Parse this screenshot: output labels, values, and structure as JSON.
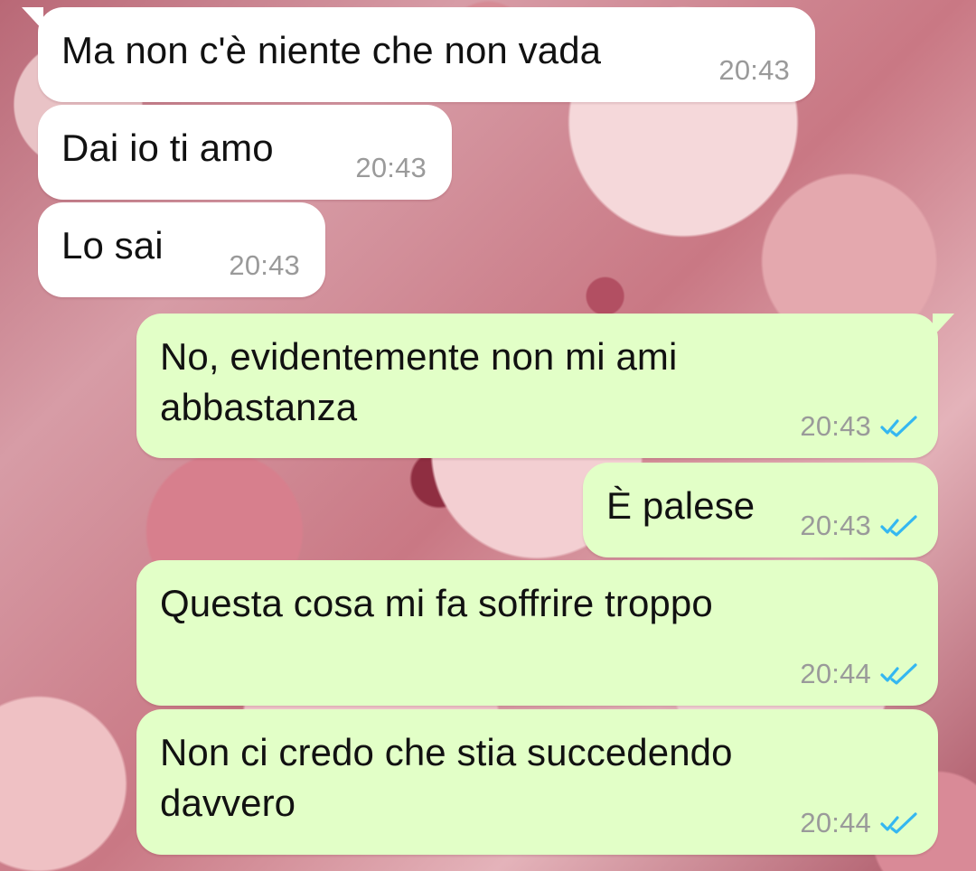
{
  "colors": {
    "incoming_bubble": "#ffffff",
    "outgoing_bubble": "#e2ffc7",
    "timestamp_text": "#9a9a9a",
    "read_receipt": "#34b7f1"
  },
  "messages": [
    {
      "direction": "incoming",
      "text": "Ma non c'è niente che non vada",
      "time": "20:43"
    },
    {
      "direction": "incoming",
      "text": "Dai io ti amo",
      "time": "20:43"
    },
    {
      "direction": "incoming",
      "text": "Lo sai",
      "time": "20:43"
    },
    {
      "direction": "outgoing",
      "text_lines": [
        "No, evidentemente non mi ami",
        "abbastanza"
      ],
      "time": "20:43",
      "status_icon": "double-check-icon"
    },
    {
      "direction": "outgoing",
      "text": "È palese",
      "time": "20:43",
      "status_icon": "double-check-icon"
    },
    {
      "direction": "outgoing",
      "text": "Questa cosa mi fa soffrire troppo",
      "time": "20:44",
      "status_icon": "double-check-icon"
    },
    {
      "direction": "outgoing",
      "text_lines": [
        "Non ci credo che stia succedendo",
        "davvero"
      ],
      "time": "20:44",
      "status_icon": "double-check-icon"
    }
  ]
}
